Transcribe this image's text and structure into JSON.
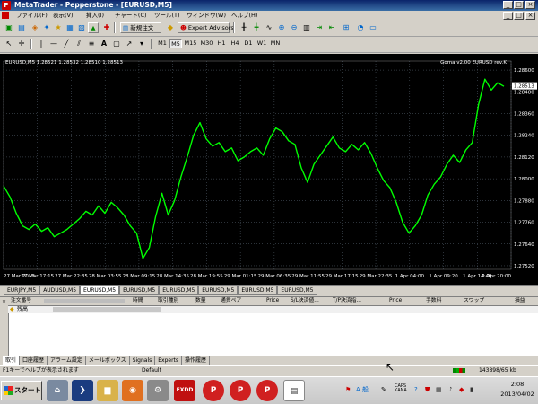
{
  "titlebar": {
    "logo": "P",
    "title": "MetaTrader - Pepperstone - [EURUSD,M5]"
  },
  "window_buttons": [
    "_",
    "□",
    "×"
  ],
  "menu": [
    "ファイル(F)",
    "表示(V)",
    "挿入(I)",
    "チャート(C)",
    "ツール(T)",
    "ウィンドウ(W)",
    "ヘルプ(H)"
  ],
  "toolbar": {
    "new_order": "新規注文",
    "expert_advisors": "Expert Advisors"
  },
  "timeframes": [
    "M1",
    "M5",
    "M15",
    "M30",
    "H1",
    "H4",
    "D1",
    "W1",
    "MN"
  ],
  "selected_timeframe": "M5",
  "chart_info": {
    "header": "EURUSD,M5  1.28521 1.28532 1.28510 1.28513",
    "indicator": "Goma v2.00 EURUSD rev.K"
  },
  "chart_data": {
    "type": "line",
    "y_ticks": [
      "1.28600",
      "1.28480",
      "1.28360",
      "1.28240",
      "1.28120",
      "1.28000",
      "1.27880",
      "1.27760",
      "1.27640",
      "1.27520"
    ],
    "current_price": "1.28513",
    "x_ticks": [
      "27 Mar 2013",
      "27 Mar 17:15",
      "27 Mar 22:35",
      "28 Mar 03:55",
      "28 Mar 09:15",
      "28 Mar 14:35",
      "28 Mar 19:55",
      "29 Mar 01:15",
      "29 Mar 06:35",
      "29 Mar 11:55",
      "29 Mar 17:15",
      "29 Mar 22:35",
      "1 Apr 04:00",
      "1 Apr 09:20",
      "1 Apr 14:40",
      "1 Apr 20:00"
    ],
    "ylim": [
      1.275,
      1.2865
    ],
    "grid": true,
    "color": "#00ff00",
    "values": [
      1.2796,
      1.279,
      1.2781,
      1.2774,
      1.2772,
      1.2775,
      1.2771,
      1.2773,
      1.2768,
      1.277,
      1.2772,
      1.2775,
      1.2778,
      1.2782,
      1.278,
      1.2785,
      1.2781,
      1.2787,
      1.2784,
      1.278,
      1.2774,
      1.277,
      1.2756,
      1.2762,
      1.2779,
      1.2792,
      1.278,
      1.2788,
      1.2801,
      1.2812,
      1.2824,
      1.2831,
      1.2822,
      1.2818,
      1.282,
      1.2815,
      1.2817,
      1.281,
      1.2812,
      1.2815,
      1.2817,
      1.2813,
      1.2822,
      1.2828,
      1.2826,
      1.2821,
      1.2819,
      1.2806,
      1.2798,
      1.2808,
      1.2813,
      1.2818,
      1.2823,
      1.2817,
      1.2815,
      1.2819,
      1.2816,
      1.282,
      1.2814,
      1.2806,
      1.2799,
      1.2795,
      1.2787,
      1.2776,
      1.277,
      1.2774,
      1.278,
      1.2791,
      1.2797,
      1.2801,
      1.2808,
      1.2813,
      1.2809,
      1.2816,
      1.282,
      1.2841,
      1.2855,
      1.2849,
      1.2853,
      1.2851
    ]
  },
  "chart_tabs": [
    "EURJPY,M5",
    "AUDUSD,M5",
    "EURUSD,M5",
    "EURUSD,M5",
    "EURUSD,M5",
    "EURUSD,M5",
    "EURUSD,M5",
    "EURUSD,M5"
  ],
  "active_chart_tab": 2,
  "terminal": {
    "columns": [
      "注文番号",
      "時間",
      "取引種別",
      "数量",
      "通貨ペア",
      "Price",
      "S/L決済値...",
      "T/P決済指...",
      "Price",
      "手数料",
      "スワップ",
      "損益"
    ],
    "balance_label": "残高"
  },
  "bottom_tabs": [
    "取引",
    "口座履歴",
    "アラーム設定",
    "メールボックス",
    "Signals",
    "Experts",
    "操作履歴"
  ],
  "active_bottom_tab": 0,
  "status": {
    "help": "F1キーでヘルプが表示されます",
    "profile": "Default",
    "traffic": "143898/65 kb"
  },
  "taskbar": {
    "start": "スタート",
    "clock_time": "2:08",
    "clock_date": "2013/04/02",
    "ime": "A 般"
  }
}
